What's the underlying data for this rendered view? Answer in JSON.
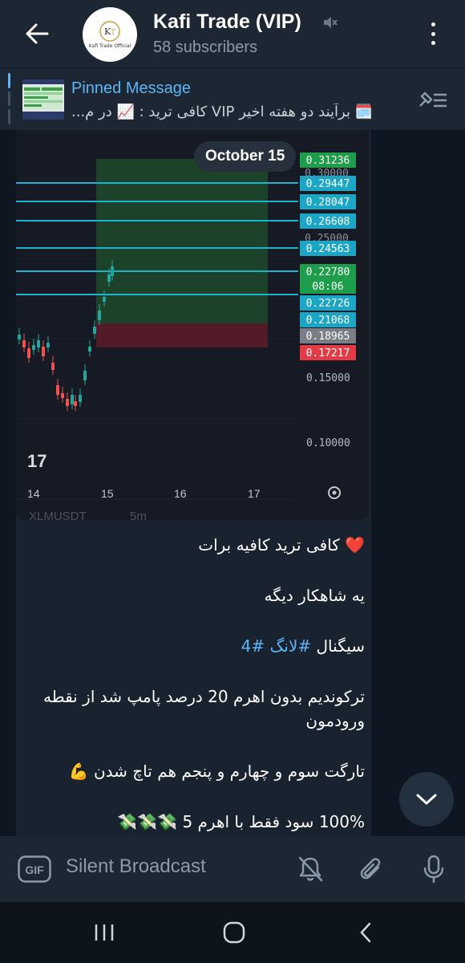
{
  "header": {
    "title": "Kafi Trade (VIP)",
    "subtitle": "58 subscribers",
    "avatar_text": "Kafi Trade Official"
  },
  "pinned": {
    "label": "Pinned Message",
    "text": "🗓️ برآیند دو هفته اخیر VIP کافی ترید : 📈 در م..."
  },
  "chart": {
    "date_pill": "October 15",
    "symbol": "XLMUSDT",
    "interval": "5m",
    "x_ticks": [
      "14",
      "15",
      "16",
      "17"
    ],
    "price_labels": [
      {
        "value": "0.31236",
        "color": "#1e9d4a"
      },
      {
        "value": "0.29447",
        "color": "#1aa6c4"
      },
      {
        "value": "0.28047",
        "color": "#1aa6c4"
      },
      {
        "value": "0.26608",
        "color": "#1aa6c4"
      },
      {
        "value": "0.24563",
        "color": "#1aa6c4"
      },
      {
        "value": "0.22780",
        "color": "#1e9d4a"
      },
      {
        "value": "08:06",
        "color": "#1e9d4a"
      },
      {
        "value": "0.22726",
        "color": "#1aa6c4"
      },
      {
        "value": "0.21068",
        "color": "#1aa6c4"
      },
      {
        "value": "0.18965",
        "color": "#7a7f87"
      },
      {
        "value": "0.17217",
        "color": "#e23b45"
      }
    ],
    "hidden_labels": [
      "0.30000",
      "0.25000"
    ],
    "axis_labels": [
      "0.15000",
      "0.10000"
    ]
  },
  "message": {
    "lines": [
      "❤️ کافی ترید کافیه برات",
      "یه شاهکار دیگه",
      "سیگنال #لانگ #4",
      "ترکوندیم بدون اهرم 20 درصد پامپ شد از نقطه ورودمون",
      "تارگت سوم و چهارم و پنجم هم تاچ شدن 💪",
      "100% سود فقط با اهرم 5 💸💸💸"
    ]
  },
  "composer": {
    "placeholder": "Silent Broadcast",
    "gif_label": "GIF"
  },
  "colors": {
    "header_bg": "#1c2733",
    "chat_bg": "#0e1621",
    "accent": "#5eb5f7"
  }
}
